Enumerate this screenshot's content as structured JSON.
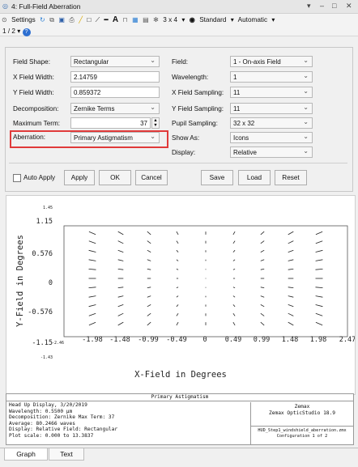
{
  "window": {
    "title": "4: Full-Field Aberration",
    "controls": [
      "▾",
      "–",
      "□",
      "✕"
    ]
  },
  "toolbar": {
    "settings_label": "Settings",
    "layout_label": "3 x 4",
    "standard_label": "Standard",
    "automatic_label": "Automatic",
    "page_label": "1 / 2"
  },
  "settings": {
    "field_shape": {
      "label": "Field Shape:",
      "value": "Rectangular"
    },
    "x_field_width": {
      "label": "X Field Width:",
      "value": "2.14759"
    },
    "y_field_width": {
      "label": "Y Field Width:",
      "value": "0.859372"
    },
    "decomposition": {
      "label": "Decomposition:",
      "value": "Zernike Terms"
    },
    "maximum_term": {
      "label": "Maximum Term:",
      "value": "37"
    },
    "aberration": {
      "label": "Aberration:",
      "value": "Primary Astigmatism"
    },
    "field": {
      "label": "Field:",
      "value": "1 - On-axis Field"
    },
    "wavelength": {
      "label": "Wavelength:",
      "value": "1"
    },
    "x_field_sampling": {
      "label": "X Field Sampling:",
      "value": "11"
    },
    "y_field_sampling": {
      "label": "Y Field Sampling:",
      "value": "11"
    },
    "pupil_sampling": {
      "label": "Pupil Sampling:",
      "value": "32 x 32"
    },
    "show_as": {
      "label": "Show As:",
      "value": "Icons"
    },
    "display": {
      "label": "Display:",
      "value": "Relative"
    }
  },
  "buttons": {
    "auto_apply": "Auto Apply",
    "apply": "Apply",
    "ok": "OK",
    "cancel": "Cancel",
    "save": "Save",
    "load": "Load",
    "reset": "Reset"
  },
  "plot": {
    "x_axis_label": "X-Field in Degrees",
    "y_axis_label": "Y-Field in Degrees",
    "x_ticks": [
      "-2.46",
      "-1.98",
      "-1.48",
      "-0.99",
      "-0.49",
      "0",
      "0.49",
      "0.99",
      "1.48",
      "1.98",
      "2.47"
    ],
    "y_ticks": [
      "1.45",
      "1.15",
      "0.576",
      "0",
      "-0.576",
      "-1.15",
      "-1.43"
    ],
    "field_x_degrees": [
      -1.98,
      -1.48,
      -0.99,
      -0.49,
      0,
      0.49,
      0.99,
      1.48,
      1.98
    ],
    "field_y_degrees": [
      0.86,
      0.69,
      0.52,
      0.34,
      0.17,
      0,
      -0.17,
      -0.34,
      -0.52,
      -0.69,
      -0.86
    ]
  },
  "info": {
    "heading": "Primary Astigmatism",
    "left_lines": [
      "Head Up Display, 3/20/2019",
      "Wavelength: 0.5500 µm",
      "Decomposition: Zernike      Max Term: 37",
      "Average: 80.2466 waves",
      "Display: Relative   Field: Rectangular",
      "Plot scale: 0.000 to 13.3837"
    ],
    "right_company": "Zemax",
    "right_product": "Zemax OpticStudio 18.9",
    "file_name": "HUD_Step1_windshield_aberration.zmx",
    "configuration": "Configuration 1 of 2"
  },
  "tabs": {
    "graph": "Graph",
    "text": "Text"
  }
}
